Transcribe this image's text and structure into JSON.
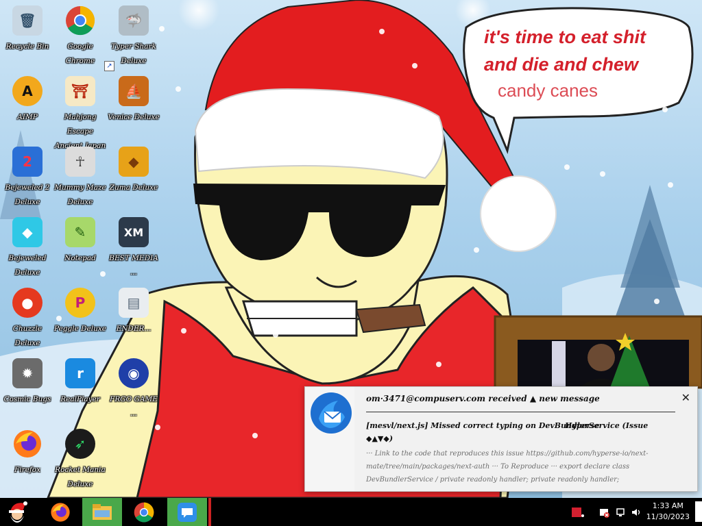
{
  "desktop": {
    "speech_bubble": {
      "line1": "it's time to eat shit",
      "line2": "and die and chew",
      "line3": "candy canes"
    },
    "icons": [
      {
        "id": "recycle-bin",
        "label": "Recycle Bin",
        "color": "#9fb7cc",
        "glyph": "🗑",
        "shortcut": false
      },
      {
        "id": "google-chrome",
        "label": "Google Chrome",
        "color": "#ffffff",
        "glyph": "",
        "shortcut": false
      },
      {
        "id": "typer-shark",
        "label": "Typer Shark Deluxe",
        "color": "#b0bdc6",
        "glyph": "🦈",
        "shortcut": true
      },
      {
        "id": "aimp",
        "label": "AIMP",
        "color": "#f2a81c",
        "glyph": "A",
        "shortcut": true
      },
      {
        "id": "mahjong",
        "label": "Mahjong Escape Ancient Japan",
        "color": "#f6e9c5",
        "glyph": "⛩",
        "shortcut": true
      },
      {
        "id": "venice",
        "label": "Venice Deluxe",
        "color": "#c96a1a",
        "glyph": "⛵",
        "shortcut": true
      },
      {
        "id": "bejeweled2",
        "label": "Bejeweled 2 Deluxe",
        "color": "#2a6fd6",
        "glyph": "2",
        "shortcut": true
      },
      {
        "id": "mummy-maze",
        "label": "Mummy Maze Deluxe",
        "color": "#dcdcdc",
        "glyph": "☥",
        "shortcut": true
      },
      {
        "id": "zuma",
        "label": "Zuma Deluxe",
        "color": "#e7a218",
        "glyph": "◆",
        "shortcut": true
      },
      {
        "id": "bejeweled",
        "label": "Bejeweled Deluxe",
        "color": "#2fc8e6",
        "glyph": "◆",
        "shortcut": true
      },
      {
        "id": "notepad",
        "label": "Notepad",
        "color": "#a7d86a",
        "glyph": "✎",
        "shortcut": true
      },
      {
        "id": "xmplay",
        "label": "BEST MEDIA ...",
        "color": "#2c3a4a",
        "glyph": "XM",
        "shortcut": true
      },
      {
        "id": "chuzzle",
        "label": "Chuzzle Deluxe",
        "color": "#e5391f",
        "glyph": "●",
        "shortcut": true
      },
      {
        "id": "peggle",
        "label": "Peggle Deluxe",
        "color": "#f2c21a",
        "glyph": "P",
        "shortcut": true
      },
      {
        "id": "ender",
        "label": "ENDER...",
        "color": "#e9edf0",
        "glyph": "▤",
        "shortcut": false
      },
      {
        "id": "cosmic-bugs",
        "label": "Cosmic Bugs",
        "color": "#6b6b6b",
        "glyph": "✹",
        "shortcut": true
      },
      {
        "id": "realplayer",
        "label": "RealPlayer",
        "color": "#1a8ae0",
        "glyph": "r",
        "shortcut": true
      },
      {
        "id": "frgo",
        "label": "FRGO GAME ...",
        "color": "#1f3fa8",
        "glyph": "◉",
        "shortcut": false
      },
      {
        "id": "firefox",
        "label": "Firefox",
        "color": "#ff6a1a",
        "glyph": "●",
        "shortcut": true
      },
      {
        "id": "rocket-mania",
        "label": "Rocket Mania Deluxe",
        "color": "#1b1b1b",
        "glyph": "➶",
        "shortcut": true
      }
    ]
  },
  "notification": {
    "sender": "om·3471@compuserv.com received ▲ new message",
    "subject": "[mesvl/next.js] Missed correct typing on DevBundlerService (Issue ◆▲▼◆)",
    "subject_right": "Hyperse",
    "preview": "··· Link to the code that reproduces this issue https://github.com/hyperse-io/next-mate/tree/main/packages/next-auth ··· To Reproduce ··· export declare class DevBundlerService / private readonly handler; private readonly handler;",
    "close_glyph": "✕"
  },
  "taskbar": {
    "start_icon": "santa-start-icon",
    "items": [
      "firefox",
      "file-explorer",
      "google-chrome",
      "speech-app"
    ],
    "clock_time": "1:33 AM",
    "clock_date": "11/30/2023"
  }
}
